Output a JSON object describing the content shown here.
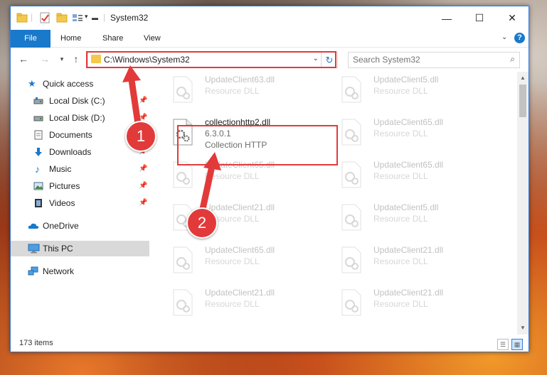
{
  "window": {
    "title": "System32",
    "controls": {
      "minimize": "—",
      "maximize": "☐",
      "close": "✕"
    }
  },
  "ribbon": {
    "tabs": [
      "File",
      "Home",
      "Share",
      "View"
    ],
    "help": "?"
  },
  "address": {
    "path": "C:\\Windows\\System32",
    "search_placeholder": "Search System32"
  },
  "nav_pane": {
    "items": [
      {
        "label": "Quick access",
        "icon": "star-icon"
      },
      {
        "label": "Local Disk (C:)",
        "icon": "drive-icon",
        "pinned": true
      },
      {
        "label": "Local Disk (D:)",
        "icon": "drive-icon",
        "pinned": true
      },
      {
        "label": "Documents",
        "icon": "documents-icon",
        "pinned": true
      },
      {
        "label": "Downloads",
        "icon": "download-icon",
        "pinned": true
      },
      {
        "label": "Music",
        "icon": "music-icon",
        "pinned": true
      },
      {
        "label": "Pictures",
        "icon": "pictures-icon",
        "pinned": true
      },
      {
        "label": "Videos",
        "icon": "videos-icon",
        "pinned": true
      },
      {
        "label": "OneDrive",
        "icon": "cloud-icon"
      },
      {
        "label": "This PC",
        "icon": "computer-icon",
        "selected": true
      },
      {
        "label": "Network",
        "icon": "network-icon"
      }
    ]
  },
  "files": [
    {
      "name": "UpdateClient63.dll",
      "type": "Resource DLL"
    },
    {
      "name": "UpdateClient5.dll",
      "type": "Resource DLL"
    },
    {
      "name": "collectionhttp2.dll",
      "version": "6.3.0.1",
      "type": "Collection HTTP",
      "highlighted": true
    },
    {
      "name": "UpdateClient65.dll",
      "type": "Resource DLL"
    },
    {
      "name": "UpdateClient65.dll",
      "type": "Resource DLL"
    },
    {
      "name": "UpdateClient65.dll",
      "type": "Resource DLL"
    },
    {
      "name": "UpdateClient21.dll",
      "type": "Resource DLL"
    },
    {
      "name": "UpdateClient5.dll",
      "type": "Resource DLL"
    },
    {
      "name": "UpdateClient65.dll",
      "type": "Resource DLL"
    },
    {
      "name": "UpdateClient21.dll",
      "type": "Resource DLL"
    },
    {
      "name": "UpdateClient21.dll",
      "type": "Resource DLL"
    },
    {
      "name": "UpdateClient21.dll",
      "type": "Resource DLL"
    }
  ],
  "status": {
    "item_count": "173 items"
  },
  "callouts": {
    "step1": "1",
    "step2": "2"
  },
  "colors": {
    "accent": "#1979ca",
    "highlight": "#e23a3a",
    "selected": "#d9d9d9"
  }
}
